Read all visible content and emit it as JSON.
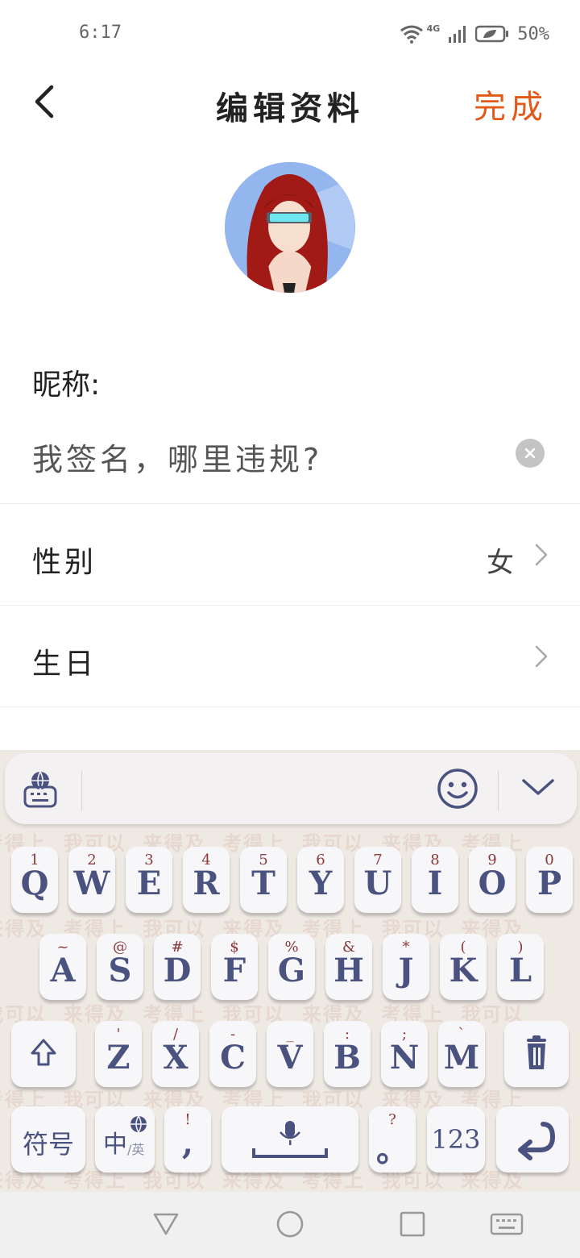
{
  "status_bar": {
    "time": "6:17",
    "network": "4G",
    "battery": "50%"
  },
  "header": {
    "back_icon": "chevron-left-icon",
    "title": "编辑资料",
    "done_label": "完成"
  },
  "profile": {
    "avatar_alt": "avatar"
  },
  "form": {
    "nickname_label": "昵称:",
    "nickname_value": "我签名，哪里违规?",
    "rows": [
      {
        "label": "性别",
        "value": "女"
      },
      {
        "label": "生日",
        "value": ""
      }
    ]
  },
  "keyboard": {
    "watermark_words": [
      "考得上",
      "我可以",
      "来得及"
    ],
    "row1": [
      {
        "hint": "1",
        "key": "Q"
      },
      {
        "hint": "2",
        "key": "W"
      },
      {
        "hint": "3",
        "key": "E"
      },
      {
        "hint": "4",
        "key": "R"
      },
      {
        "hint": "5",
        "key": "T"
      },
      {
        "hint": "6",
        "key": "Y"
      },
      {
        "hint": "7",
        "key": "U"
      },
      {
        "hint": "8",
        "key": "I"
      },
      {
        "hint": "9",
        "key": "O"
      },
      {
        "hint": "0",
        "key": "P"
      }
    ],
    "row2": [
      {
        "hint": "~",
        "key": "A"
      },
      {
        "hint": "@",
        "key": "S"
      },
      {
        "hint": "#",
        "key": "D"
      },
      {
        "hint": "$",
        "key": "F"
      },
      {
        "hint": "%",
        "key": "G"
      },
      {
        "hint": "&",
        "key": "H"
      },
      {
        "hint": "*",
        "key": "J"
      },
      {
        "hint": "(",
        "key": "K"
      },
      {
        "hint": ")",
        "key": "L"
      }
    ],
    "row3": [
      {
        "hint": "'",
        "key": "Z"
      },
      {
        "hint": "/",
        "key": "X"
      },
      {
        "hint": "-",
        "key": "C"
      },
      {
        "hint": "_",
        "key": "V"
      },
      {
        "hint": ":",
        "key": "B"
      },
      {
        "hint": ";",
        "key": "N"
      },
      {
        "hint": "`",
        "key": "M"
      }
    ],
    "symbols_label": "符号",
    "lang_main": "中",
    "lang_sub": "/英",
    "comma_hint": "!",
    "comma_key": ",",
    "period_hint": "?",
    "period_key": "。",
    "num_label": "123"
  }
}
